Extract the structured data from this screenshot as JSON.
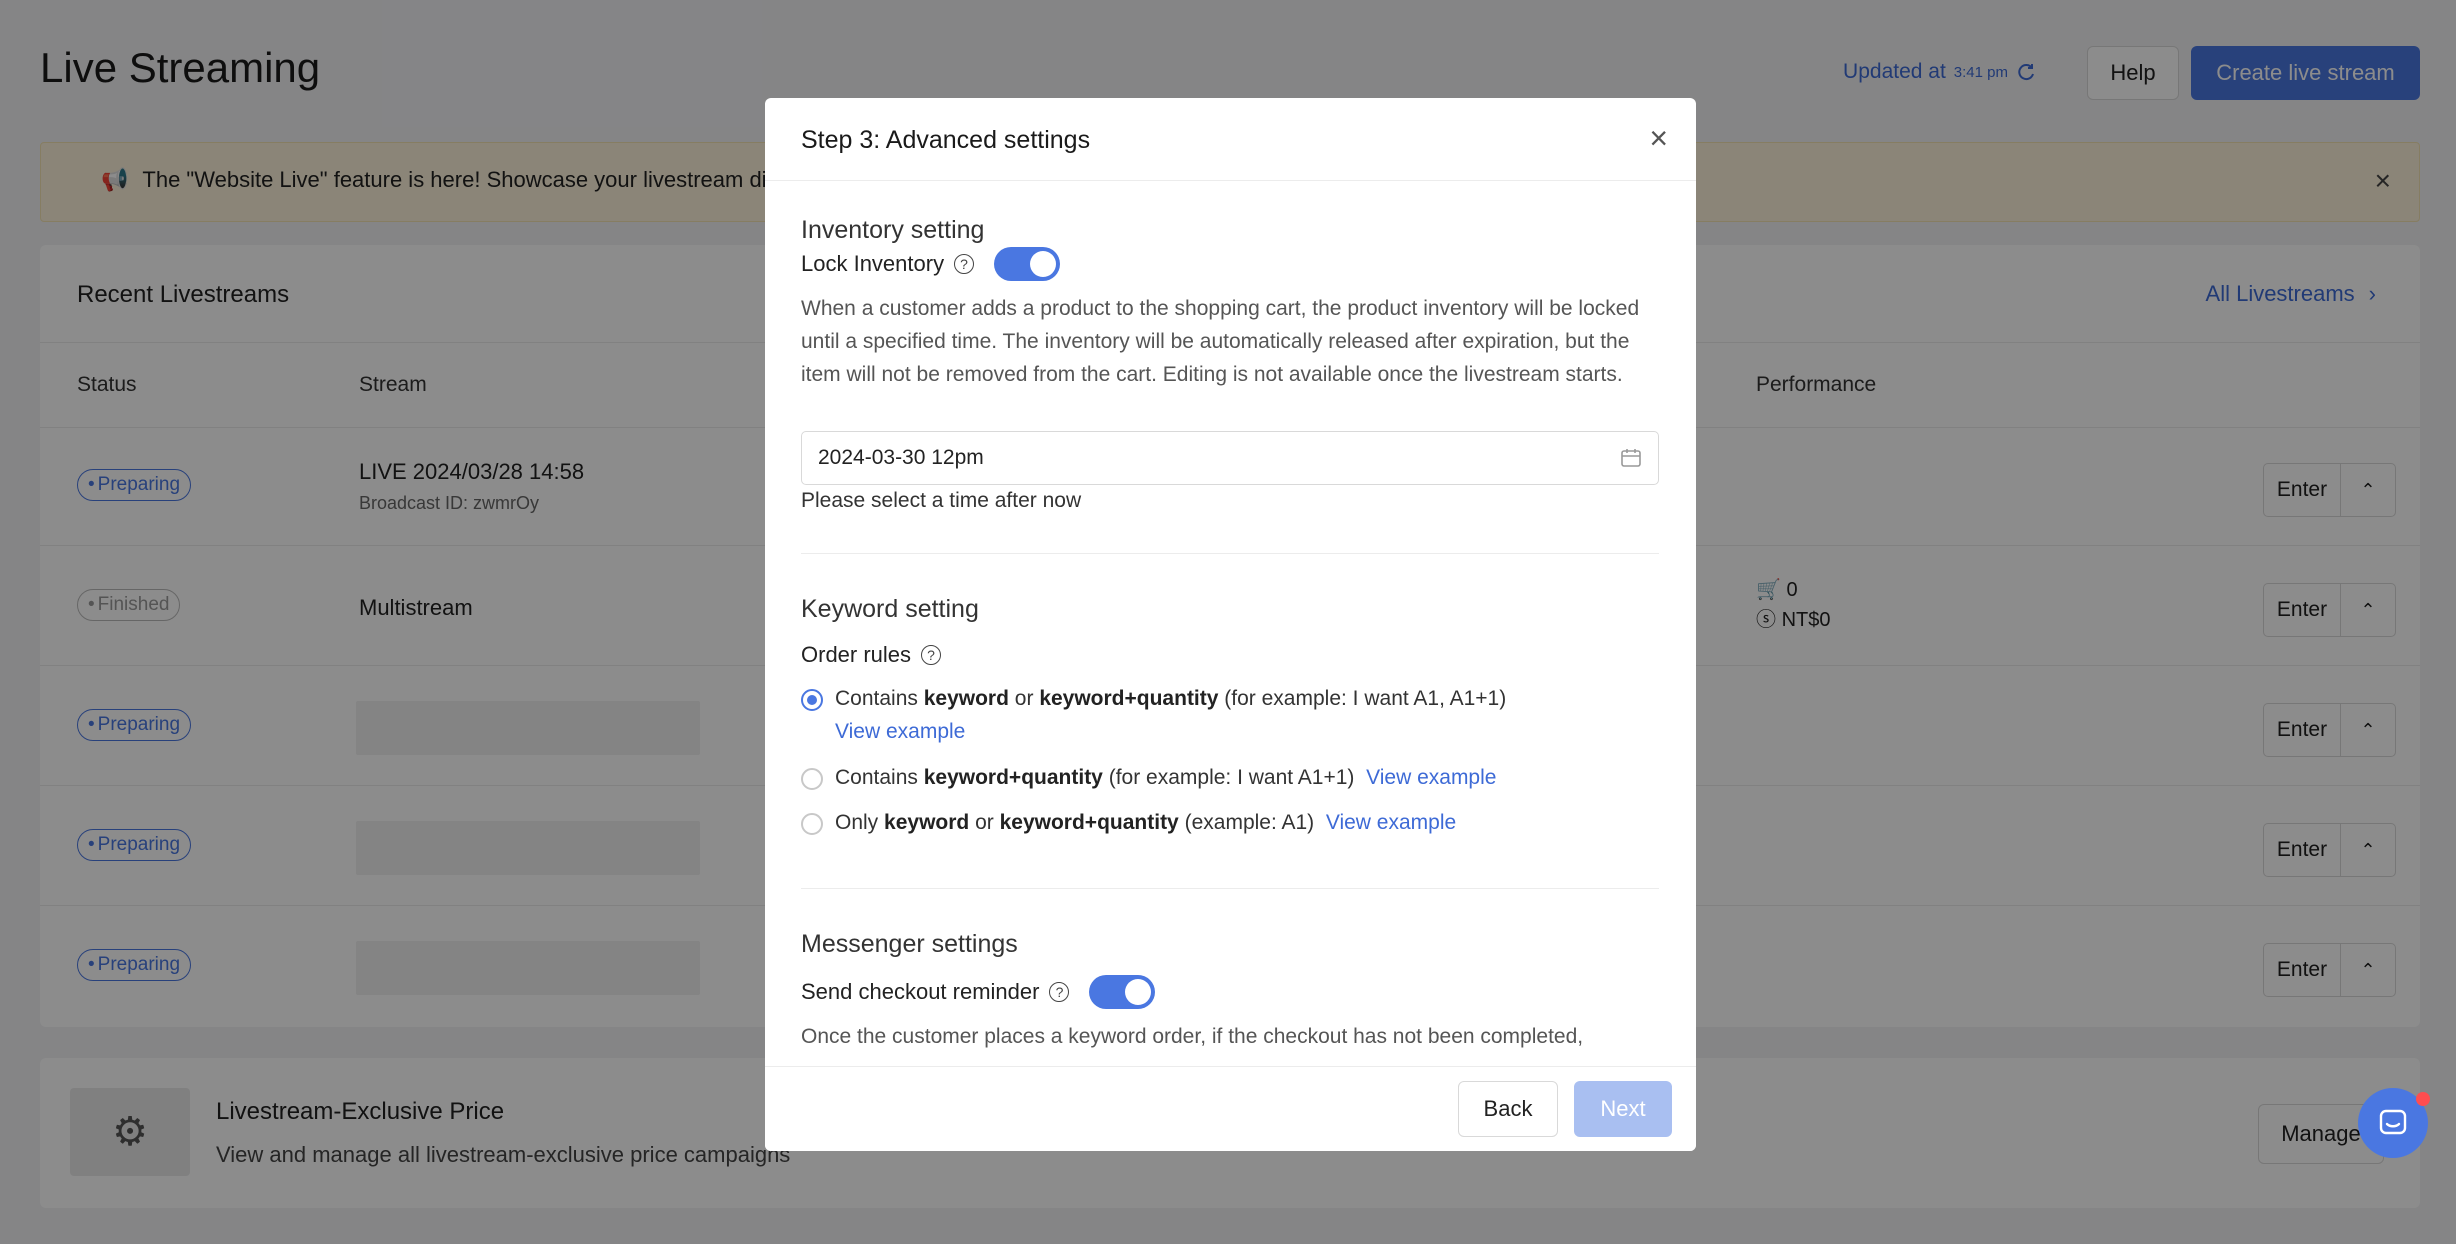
{
  "page": {
    "title": "Live Streaming",
    "updated_label": "Updated at",
    "updated_time": "3:41 pm",
    "help_label": "Help",
    "create_label": "Create live stream"
  },
  "banner": {
    "text": "The \"Website Live\" feature is here! Showcase your livestream dire"
  },
  "recent": {
    "title": "Recent Livestreams",
    "all_link": "All Livestreams",
    "columns": {
      "status": "Status",
      "stream": "Stream",
      "performance": "Performance"
    },
    "rows": [
      {
        "status": "Preparing",
        "title": "LIVE 2024/03/28 14:58",
        "sub": "Broadcast ID: zwmrOy",
        "enter": "Enter"
      },
      {
        "status": "Finished",
        "title": "Multistream",
        "orders": "0",
        "revenue": "NT$0",
        "enter": "Enter"
      },
      {
        "status": "Preparing",
        "enter": "Enter"
      },
      {
        "status": "Preparing",
        "enter": "Enter"
      },
      {
        "status": "Preparing",
        "enter": "Enter"
      }
    ]
  },
  "price": {
    "title": "Livestream-Exclusive Price",
    "sub": "View and manage all livestream-exclusive price campaigns",
    "manage": "Manage"
  },
  "modal": {
    "title": "Step 3: Advanced settings",
    "inventory": {
      "section": "Inventory setting",
      "lock_label": "Lock Inventory",
      "desc": "When a customer adds a product to the shopping cart, the product inventory will be locked until a specified time. The inventory will be automatically released after expiration, but the item will not be removed from the cart. Editing is not available once the livestream starts.",
      "date_value": "2024-03-30 12pm",
      "hint": "Please select a time after now"
    },
    "keyword": {
      "section": "Keyword setting",
      "order_rules": "Order rules",
      "opt1": {
        "pre": "Contains",
        "k1": "keyword",
        "or": "or",
        "k2": "keyword+quantity",
        "ex": "(for example: I want A1, A1+1)",
        "link": "View example"
      },
      "opt2": {
        "pre": "Contains",
        "k2": "keyword+quantity",
        "ex": "(for example: I want A1+1)",
        "link": "View example"
      },
      "opt3": {
        "pre": "Only",
        "k1": "keyword",
        "or": "or",
        "k2": "keyword+quantity",
        "ex": "(example: A1)",
        "link": "View example"
      }
    },
    "messenger": {
      "section": "Messenger settings",
      "reminder_label": "Send checkout reminder",
      "desc": "Once the customer places a keyword order, if the checkout has not been completed,"
    },
    "back": "Back",
    "next": "Next"
  }
}
